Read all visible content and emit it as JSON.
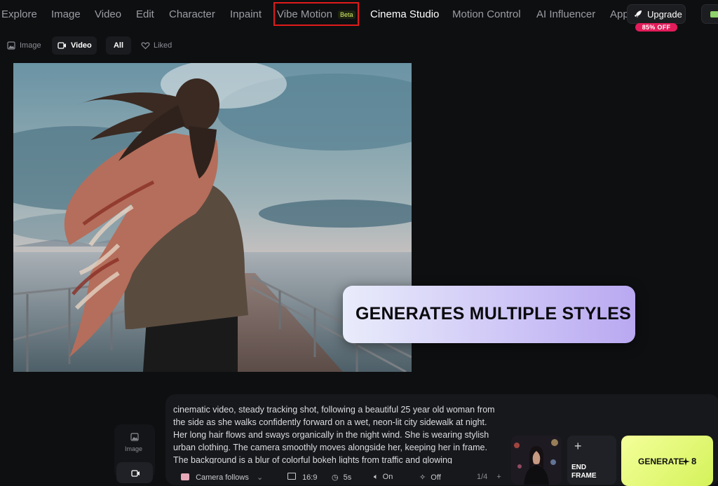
{
  "nav": {
    "items": [
      "Explore",
      "Image",
      "Video",
      "Edit",
      "Character",
      "Inpaint",
      "Vibe Motion",
      "Cinema Studio",
      "Motion Control",
      "AI Influencer",
      "App"
    ],
    "beta_badge": "Beta",
    "upgrade_label": "Upgrade",
    "discount_badge": "85% OFF"
  },
  "filters": {
    "image": "Image",
    "video": "Video",
    "all": "All",
    "liked": "Liked"
  },
  "banner": {
    "text": "GENERATES MULTIPLE STYLES"
  },
  "side": {
    "image_label": "Image"
  },
  "composer": {
    "prompt": "cinematic video, steady tracking shot, following a beautiful 25 year old woman from the side as she walks confidently forward on a wet, neon-lit city sidewalk at night. Her long hair flows and sways organically in the night wind. She is wearing stylish urban clothing. The camera smoothly moves alongside her, keeping her in frame. The background is a blur of colorful bokeh lights from traffic and glowing",
    "camera": "Camera follows",
    "ratio": "16:9",
    "duration": "5s",
    "audio": "On",
    "mode": "Off",
    "count": "1/4",
    "end_frame_label": "END FRAME",
    "generate_label": "GENERATE",
    "generate_cost": "8"
  },
  "colors": {
    "accent_red": "#e01b1b",
    "generate_yellow": "#e2f56f",
    "discount_pink": "#e21c5b"
  }
}
